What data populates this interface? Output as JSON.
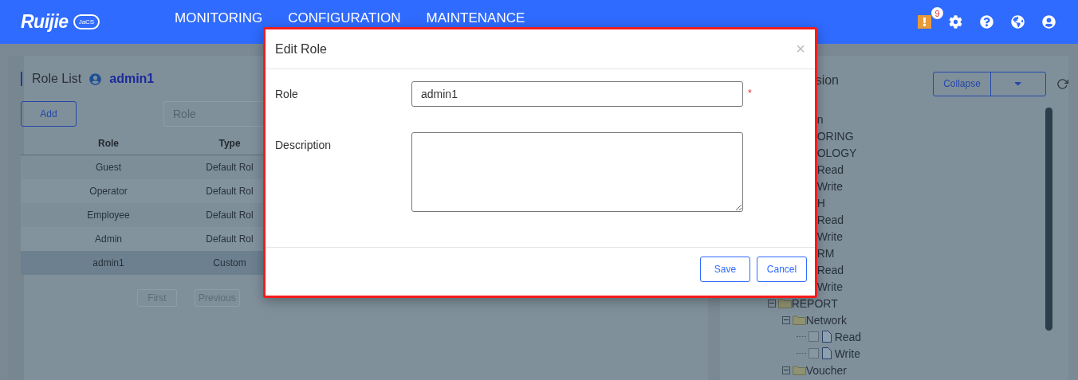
{
  "header": {
    "logo": "Ruijie",
    "logo_badge": "JaCS",
    "nav": [
      {
        "label": "MONITORING",
        "selected": false
      },
      {
        "label": "CONFIGURATION",
        "selected": false
      },
      {
        "label": "MAINTENANCE",
        "selected": false
      }
    ],
    "alert_count": "9"
  },
  "role_list": {
    "title": "Role List",
    "user": "admin1",
    "add_button": "Add",
    "search": {
      "placeholder": "Role"
    },
    "columns": [
      "Role",
      "Type"
    ],
    "rows": [
      {
        "role": "Guest",
        "type": "Default Rol",
        "selected": false
      },
      {
        "role": "Operator",
        "type": "Default Rol",
        "selected": false
      },
      {
        "role": "Employee",
        "type": "Default Rol",
        "selected": false
      },
      {
        "role": "Admin",
        "type": "Default Rol",
        "selected": false
      },
      {
        "role": "admin1",
        "type": "Custom",
        "selected": true
      }
    ],
    "pagination": [
      "First",
      "Previous"
    ]
  },
  "permission": {
    "title": "sion",
    "collapse_button": "Collapse",
    "tree": [
      {
        "label": "n",
        "children": [
          {
            "label": "ORING"
          },
          {
            "label": "OLOGY",
            "children": [
              {
                "label": "Read"
              },
              {
                "label": "Write"
              }
            ]
          },
          {
            "label": "H",
            "children": [
              {
                "label": "Read"
              },
              {
                "label": "Write"
              }
            ]
          },
          {
            "label": "RM",
            "children": [
              {
                "label": "Read"
              },
              {
                "label": "Write"
              }
            ]
          },
          {
            "label": "REPORT",
            "kind": "folder",
            "expanded": true,
            "children": [
              {
                "label": "Network",
                "kind": "folder",
                "expanded": true,
                "children": [
                  {
                    "label": "Read",
                    "kind": "file",
                    "checked": false
                  },
                  {
                    "label": "Write",
                    "kind": "file",
                    "checked": false
                  }
                ]
              },
              {
                "label": "Voucher",
                "kind": "folder",
                "expanded": true
              }
            ]
          }
        ]
      }
    ]
  },
  "dialog": {
    "title": "Edit Role",
    "close": "×",
    "fields": [
      {
        "label": "Role",
        "kind": "input",
        "value": "admin1",
        "required": "*"
      },
      {
        "label": "Description",
        "kind": "textarea"
      }
    ],
    "buttons": [
      "Save",
      "Cancel"
    ]
  }
}
